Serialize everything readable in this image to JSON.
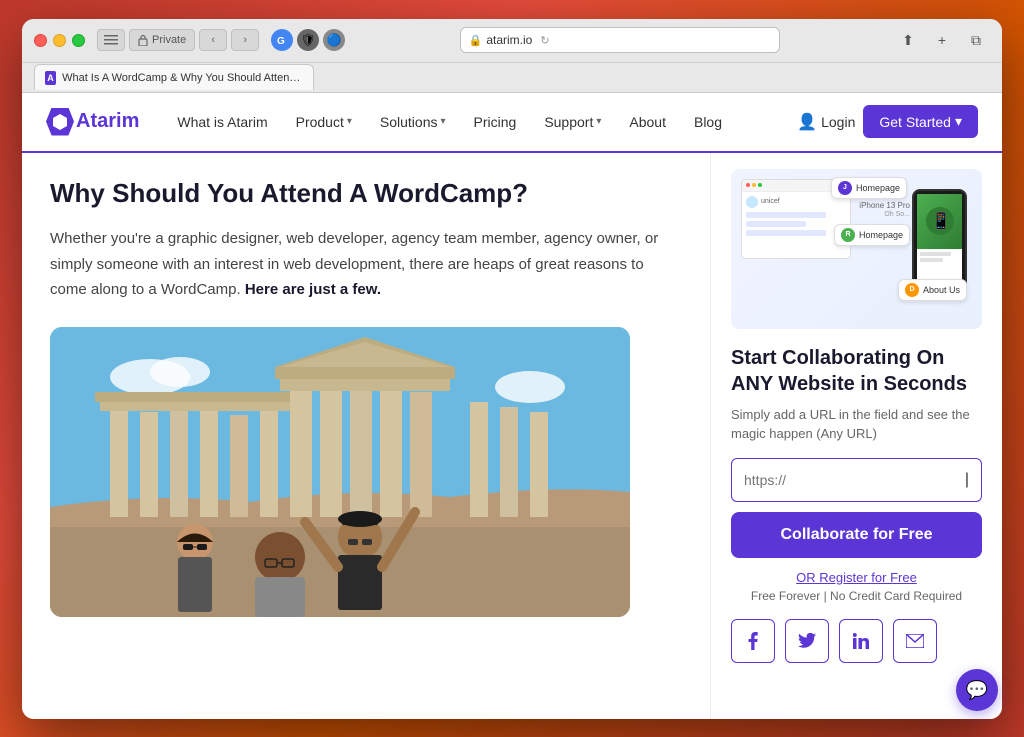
{
  "browser": {
    "url": "atarim.io",
    "tab_title": "What Is A WordCamp & Why You Should Attend Them | Atarim",
    "private_label": "Private"
  },
  "nav": {
    "logo_text_a": "A",
    "logo_name": "tarim",
    "items": [
      {
        "label": "What is Atarim",
        "has_dropdown": false
      },
      {
        "label": "Product",
        "has_dropdown": true
      },
      {
        "label": "Solutions",
        "has_dropdown": true
      },
      {
        "label": "Pricing",
        "has_dropdown": false
      },
      {
        "label": "Support",
        "has_dropdown": true
      },
      {
        "label": "About",
        "has_dropdown": false
      },
      {
        "label": "Blog",
        "has_dropdown": false
      }
    ],
    "login_label": "Login",
    "get_started_label": "Get Started"
  },
  "main": {
    "title": "Why Should You Attend A WordCamp?",
    "description": "Whether you're a graphic designer, web developer, agency team member, agency owner, or simply someone with an interest in web development, there are heaps of great reasons to come along to a WordCamp.",
    "description_bold": "Here are just a few."
  },
  "sidebar": {
    "cta_title": "Start Collaborating On ANY Website in Seconds",
    "cta_desc": "Simply add a URL in the field and see the magic happen (Any URL)",
    "url_placeholder": "https://",
    "collaborate_btn": "Collaborate for Free",
    "register_link": "OR Register for Free",
    "free_text": "Free Forever | No Credit Card Required",
    "social": {
      "facebook": "f",
      "twitter": "t",
      "linkedin": "in",
      "email": "✉"
    }
  },
  "comments": [
    {
      "initials": "J",
      "text": "Homepage"
    },
    {
      "initials": "R",
      "text": "Homepage"
    },
    {
      "initials": "D",
      "text": "About Us"
    }
  ],
  "colors": {
    "brand_purple": "#5b35d5",
    "text_dark": "#1a1a2e",
    "text_body": "#444"
  }
}
